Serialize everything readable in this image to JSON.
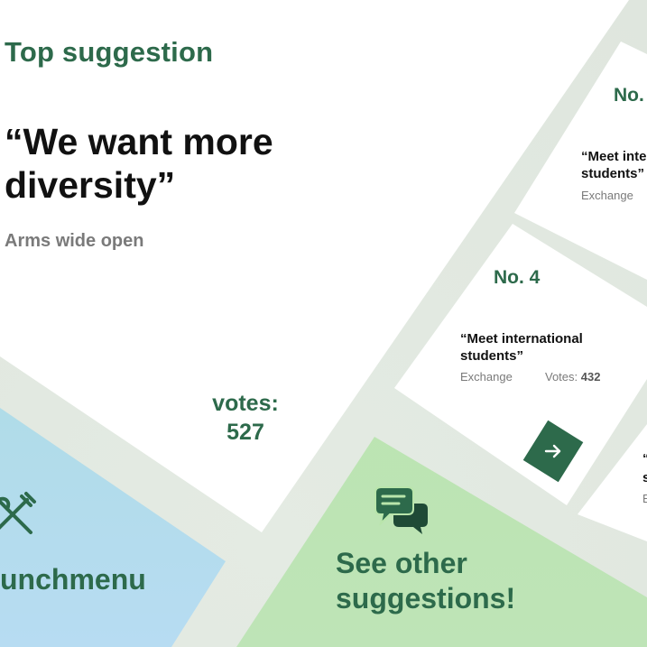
{
  "top": {
    "label": "Top suggestion",
    "quote": "“We want more diversity”",
    "subtitle": "Arms wide open",
    "votes_label": "votes:",
    "votes_value": "527"
  },
  "tiles": {
    "lunch": {
      "label": "unchmenu",
      "icon": "fork-knife-icon"
    },
    "see_other": {
      "label": "See other suggestions!",
      "icon": "chat-bubbles-icon"
    }
  },
  "cards": [
    {
      "number": "No.",
      "title": "“Meet inte students”",
      "category": "Exchange"
    },
    {
      "number": "No. 4",
      "title": "“Meet international students”",
      "category": "Exchange",
      "votes_label": "Votes:",
      "votes_value": "432"
    }
  ],
  "glyphs": {
    "g1": "“",
    "g2": "s",
    "g3": "E",
    "g4": "4"
  },
  "colors": {
    "accent": "#2d6a4b",
    "lunch_tile": "#a9dcdc",
    "see_tile": "#b9e5ab"
  }
}
